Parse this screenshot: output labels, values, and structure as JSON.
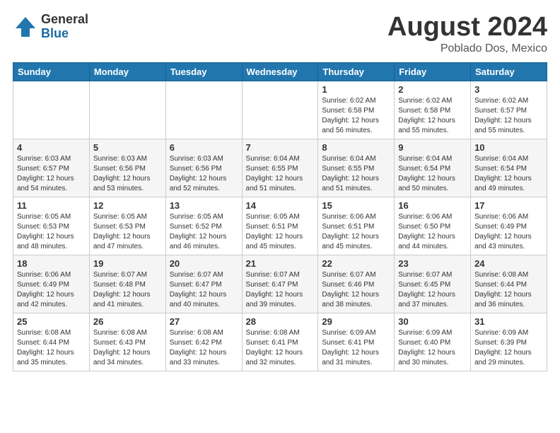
{
  "header": {
    "logo_general": "General",
    "logo_blue": "Blue",
    "month_title": "August 2024",
    "location": "Poblado Dos, Mexico"
  },
  "weekdays": [
    "Sunday",
    "Monday",
    "Tuesday",
    "Wednesday",
    "Thursday",
    "Friday",
    "Saturday"
  ],
  "weeks": [
    [
      {
        "day": "",
        "info": ""
      },
      {
        "day": "",
        "info": ""
      },
      {
        "day": "",
        "info": ""
      },
      {
        "day": "",
        "info": ""
      },
      {
        "day": "1",
        "info": "Sunrise: 6:02 AM\nSunset: 6:58 PM\nDaylight: 12 hours\nand 56 minutes."
      },
      {
        "day": "2",
        "info": "Sunrise: 6:02 AM\nSunset: 6:58 PM\nDaylight: 12 hours\nand 55 minutes."
      },
      {
        "day": "3",
        "info": "Sunrise: 6:02 AM\nSunset: 6:57 PM\nDaylight: 12 hours\nand 55 minutes."
      }
    ],
    [
      {
        "day": "4",
        "info": "Sunrise: 6:03 AM\nSunset: 6:57 PM\nDaylight: 12 hours\nand 54 minutes."
      },
      {
        "day": "5",
        "info": "Sunrise: 6:03 AM\nSunset: 6:56 PM\nDaylight: 12 hours\nand 53 minutes."
      },
      {
        "day": "6",
        "info": "Sunrise: 6:03 AM\nSunset: 6:56 PM\nDaylight: 12 hours\nand 52 minutes."
      },
      {
        "day": "7",
        "info": "Sunrise: 6:04 AM\nSunset: 6:55 PM\nDaylight: 12 hours\nand 51 minutes."
      },
      {
        "day": "8",
        "info": "Sunrise: 6:04 AM\nSunset: 6:55 PM\nDaylight: 12 hours\nand 51 minutes."
      },
      {
        "day": "9",
        "info": "Sunrise: 6:04 AM\nSunset: 6:54 PM\nDaylight: 12 hours\nand 50 minutes."
      },
      {
        "day": "10",
        "info": "Sunrise: 6:04 AM\nSunset: 6:54 PM\nDaylight: 12 hours\nand 49 minutes."
      }
    ],
    [
      {
        "day": "11",
        "info": "Sunrise: 6:05 AM\nSunset: 6:53 PM\nDaylight: 12 hours\nand 48 minutes."
      },
      {
        "day": "12",
        "info": "Sunrise: 6:05 AM\nSunset: 6:53 PM\nDaylight: 12 hours\nand 47 minutes."
      },
      {
        "day": "13",
        "info": "Sunrise: 6:05 AM\nSunset: 6:52 PM\nDaylight: 12 hours\nand 46 minutes."
      },
      {
        "day": "14",
        "info": "Sunrise: 6:05 AM\nSunset: 6:51 PM\nDaylight: 12 hours\nand 45 minutes."
      },
      {
        "day": "15",
        "info": "Sunrise: 6:06 AM\nSunset: 6:51 PM\nDaylight: 12 hours\nand 45 minutes."
      },
      {
        "day": "16",
        "info": "Sunrise: 6:06 AM\nSunset: 6:50 PM\nDaylight: 12 hours\nand 44 minutes."
      },
      {
        "day": "17",
        "info": "Sunrise: 6:06 AM\nSunset: 6:49 PM\nDaylight: 12 hours\nand 43 minutes."
      }
    ],
    [
      {
        "day": "18",
        "info": "Sunrise: 6:06 AM\nSunset: 6:49 PM\nDaylight: 12 hours\nand 42 minutes."
      },
      {
        "day": "19",
        "info": "Sunrise: 6:07 AM\nSunset: 6:48 PM\nDaylight: 12 hours\nand 41 minutes."
      },
      {
        "day": "20",
        "info": "Sunrise: 6:07 AM\nSunset: 6:47 PM\nDaylight: 12 hours\nand 40 minutes."
      },
      {
        "day": "21",
        "info": "Sunrise: 6:07 AM\nSunset: 6:47 PM\nDaylight: 12 hours\nand 39 minutes."
      },
      {
        "day": "22",
        "info": "Sunrise: 6:07 AM\nSunset: 6:46 PM\nDaylight: 12 hours\nand 38 minutes."
      },
      {
        "day": "23",
        "info": "Sunrise: 6:07 AM\nSunset: 6:45 PM\nDaylight: 12 hours\nand 37 minutes."
      },
      {
        "day": "24",
        "info": "Sunrise: 6:08 AM\nSunset: 6:44 PM\nDaylight: 12 hours\nand 36 minutes."
      }
    ],
    [
      {
        "day": "25",
        "info": "Sunrise: 6:08 AM\nSunset: 6:44 PM\nDaylight: 12 hours\nand 35 minutes."
      },
      {
        "day": "26",
        "info": "Sunrise: 6:08 AM\nSunset: 6:43 PM\nDaylight: 12 hours\nand 34 minutes."
      },
      {
        "day": "27",
        "info": "Sunrise: 6:08 AM\nSunset: 6:42 PM\nDaylight: 12 hours\nand 33 minutes."
      },
      {
        "day": "28",
        "info": "Sunrise: 6:08 AM\nSunset: 6:41 PM\nDaylight: 12 hours\nand 32 minutes."
      },
      {
        "day": "29",
        "info": "Sunrise: 6:09 AM\nSunset: 6:41 PM\nDaylight: 12 hours\nand 31 minutes."
      },
      {
        "day": "30",
        "info": "Sunrise: 6:09 AM\nSunset: 6:40 PM\nDaylight: 12 hours\nand 30 minutes."
      },
      {
        "day": "31",
        "info": "Sunrise: 6:09 AM\nSunset: 6:39 PM\nDaylight: 12 hours\nand 29 minutes."
      }
    ]
  ]
}
